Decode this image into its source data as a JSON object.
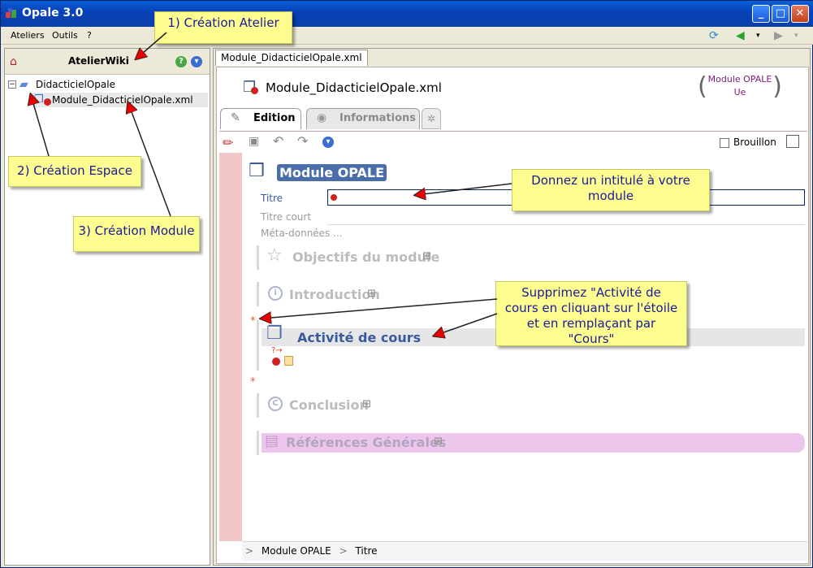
{
  "window": {
    "title": "Opale 3.0",
    "buttons": {
      "minimize": "_",
      "maximize": "□",
      "close": "✕"
    }
  },
  "menu": [
    "Ateliers",
    "Outils",
    "?"
  ],
  "left_panel": {
    "title": "AtelierWiki",
    "tree": [
      {
        "label": "DidacticielOpale"
      },
      {
        "label": "Module_DidacticielOpale.xml"
      }
    ]
  },
  "right_panel": {
    "file_tab": "Module_DidacticielOpale.xml",
    "doc_name": "Module_DidacticielOpale.xml",
    "model": {
      "line1": "Module OPALE",
      "line2": "Ue"
    },
    "tabs": {
      "edition": "Edition",
      "informations": "Informations"
    },
    "brouillon": "Brouillon",
    "module_title": "Module OPALE",
    "fields": {
      "titre": "Titre",
      "titre_court": "Titre court",
      "meta": "Méta-données ..."
    },
    "sections": [
      "Objectifs du module",
      "Introduction",
      "Activité de cours",
      "Conclusion",
      "Références Générales"
    ],
    "breadcrumb": {
      "sep": ">",
      "item1": "Module OPALE",
      "item2": "Titre"
    }
  },
  "annotations": {
    "n1": "1) Création Atelier",
    "n2": "2) Création Espace",
    "n3": "3) Création Module",
    "n4": "Donnez un intitulé à  votre module",
    "n5": "Supprimez \"Activité de cours en cliquant sur l'étoile et en remplaçant par \"Cours\""
  },
  "colors": {
    "accent": "#4a6ea9",
    "red_arrow": "#e80000",
    "note_bg": "#fdfd90"
  }
}
